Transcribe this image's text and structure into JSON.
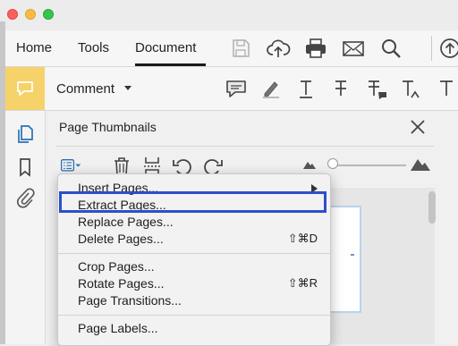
{
  "toolbar": {
    "tabs": [
      {
        "label": "Home"
      },
      {
        "label": "Tools"
      },
      {
        "label": "Document"
      }
    ]
  },
  "comment": {
    "label": "Comment"
  },
  "panel": {
    "title": "Page Thumbnails"
  },
  "menu": {
    "items": [
      {
        "label": "Insert Pages...",
        "shortcut": ""
      },
      {
        "label": "Extract Pages...",
        "shortcut": ""
      },
      {
        "label": "Replace Pages...",
        "shortcut": ""
      },
      {
        "label": "Delete Pages...",
        "shortcut": "⇧⌘D"
      },
      {
        "label": "Crop Pages...",
        "shortcut": ""
      },
      {
        "label": "Rotate Pages...",
        "shortcut": "⇧⌘R"
      },
      {
        "label": "Page Transitions...",
        "shortcut": ""
      },
      {
        "label": "Page Labels...",
        "shortcut": ""
      }
    ]
  },
  "colors": {
    "highlight": "#2a4fcd",
    "comment_badge": "#f6d26a",
    "accent_blue": "#2b6fb6"
  }
}
